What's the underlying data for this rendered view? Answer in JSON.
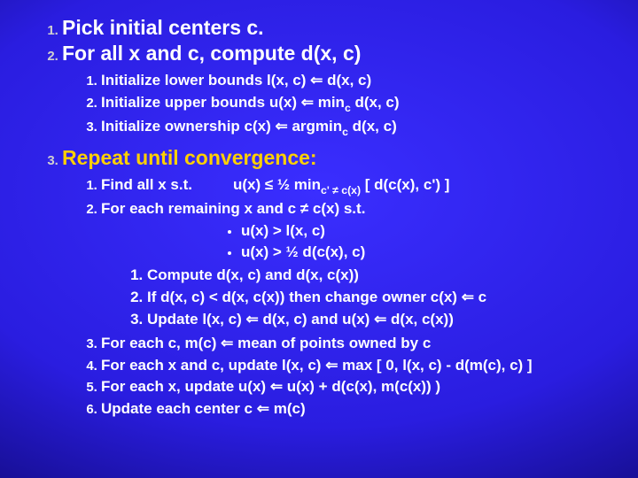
{
  "slide": {
    "items": [
      {
        "text": "Pick initial centers c."
      },
      {
        "text": "For all x and c, compute d(x, c)",
        "sub": [
          "Initialize lower bounds l(x, c) ⇐ d(x, c)",
          "Initialize upper bounds u(x) ⇐ min_c d(x, c)",
          "Initialize ownership c(x) ⇐ argmin_c d(x, c)"
        ]
      },
      {
        "text": "Repeat until convergence:",
        "highlight": true,
        "sub3": {
          "s1": "Find all x s.t.",
          "s1b": "u(x) ≤ ½ min_c'≠c(x) [ d(c(x), c') ]",
          "s2a": "For each remaining x and c ≠ c(x) s.t.",
          "bullets": [
            "u(x) > l(x, c)",
            "u(x) > ½ d(c(x), c)"
          ],
          "subsub": [
            "Compute d(x, c) and d(x, c(x))",
            "If d(x, c) < d(x, c(x)) then change owner c(x) ⇐ c",
            "Update l(x, c) ⇐ d(x, c) and u(x) ⇐ d(x, c(x))"
          ],
          "s3": "For each c, m(c) ⇐ mean of points owned by c",
          "s4": "For each x and c, update l(x, c) ⇐ max [ 0, l(x, c) - d(m(c), c) ]",
          "s5": "For each x, update u(x) ⇐ u(x) + d(c(x), m(c(x)) )",
          "s6": "Update each center c ⇐ m(c)"
        }
      }
    ]
  }
}
